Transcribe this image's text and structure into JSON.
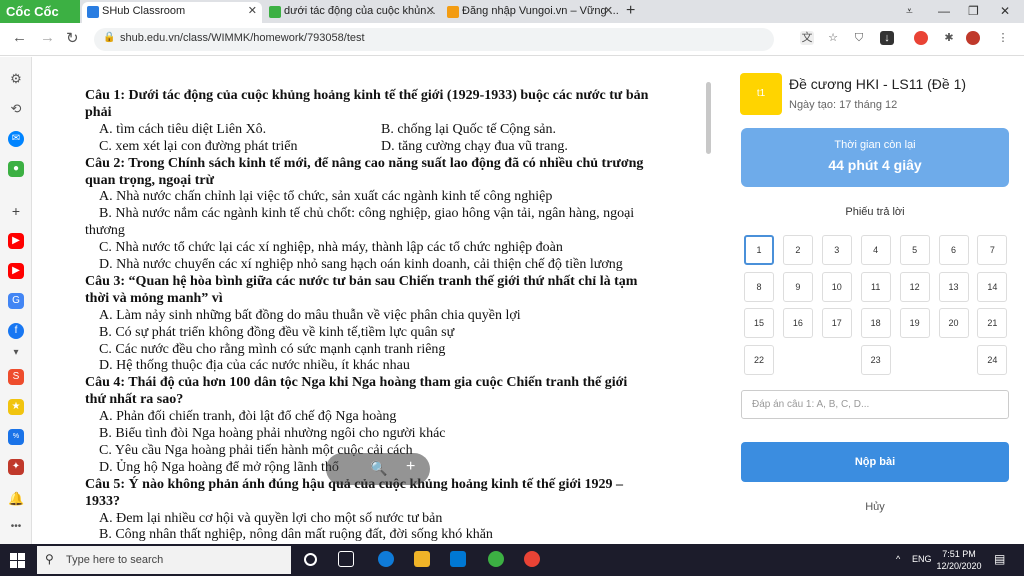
{
  "browser": {
    "brand": "Cốc Cốc",
    "tabs": [
      {
        "title": "SHub Classroom",
        "active": true
      },
      {
        "title": "dưới tác động của cuộc khủn...",
        "active": false
      },
      {
        "title": "Đăng nhập Vungoi.vn – Vững ...",
        "active": false
      }
    ],
    "url": "shub.edu.vn/class/WIMMK/homework/793058/test"
  },
  "document": {
    "lines": [
      {
        "kind": "q",
        "text": "Câu 1: Dưới tác động của cuộc khủng hoảng kinh tế thế giới (1929-1933) buộc các nước tư bản"
      },
      {
        "kind": "q",
        "text": "phải"
      },
      {
        "kind": "pair",
        "left": "A. tìm cách tiêu diệt Liên Xô.",
        "right": "B. chống lại Quốc tế Cộng sản."
      },
      {
        "kind": "pair",
        "left": "C. xem xét lại con đường phát triển",
        "right": "D. tăng cường chạy đua vũ trang."
      },
      {
        "kind": "q",
        "text": "Câu 2: Trong Chính sách kinh tế mới, để nâng cao năng suất lao động đã có nhiều chủ trương"
      },
      {
        "kind": "q",
        "text": "quan trọng, ngoại trừ"
      },
      {
        "kind": "a",
        "text": "A. Nhà nước chấn chỉnh lại việc tổ chức, sản xuất các ngành kinh tế công nghiệp"
      },
      {
        "kind": "a",
        "text": "B. Nhà nước nắm các ngành kinh tế chủ chốt: công nghiệp, giao hông vận tải, ngân hàng, ngoại"
      },
      {
        "kind": "w",
        "text": "thương"
      },
      {
        "kind": "a",
        "text": "C. Nhà nước tổ chức lại các xí nghiệp, nhà máy, thành lập các tổ chức nghiệp đoàn"
      },
      {
        "kind": "a",
        "text": "D. Nhà nước chuyển các xí nghiệp nhỏ sang hạch oán kinh doanh, cải thiện chế độ tiền lương"
      },
      {
        "kind": "q",
        "text": "Câu 3: “Quan hệ hòa bình giữa các nước tư bản sau Chiến tranh thế giới thứ nhất chỉ là tạm"
      },
      {
        "kind": "q",
        "text": "thời và mỏng manh” vì"
      },
      {
        "kind": "a",
        "text": "A. Làm nảy sinh những bất đồng do mâu thuẫn về việc phân chia quyền lợi"
      },
      {
        "kind": "a",
        "text": "B. Có sự phát triển không đồng đều về kinh tế,tiềm lực quân sự"
      },
      {
        "kind": "a",
        "text": "C. Các nước đều cho rằng mình có sức mạnh cạnh tranh riêng"
      },
      {
        "kind": "a",
        "text": "D. Hệ thống thuộc địa của các nước nhiều, ít khác nhau"
      },
      {
        "kind": "q",
        "text": "Câu 4: Thái độ của hơn 100 dân tộc Nga khi Nga hoàng tham gia cuộc Chiến tranh thế giới"
      },
      {
        "kind": "q",
        "text": "thứ nhất ra sao?"
      },
      {
        "kind": "a",
        "text": "A. Phản đối chiến tranh, đòi lật đổ chế độ Nga hoàng"
      },
      {
        "kind": "a",
        "text": "B. Biểu tình đòi Nga hoàng phải nhường ngôi cho người khác"
      },
      {
        "kind": "a",
        "text": "C. Yêu cầu Nga hoàng phải tiến hành một cuộc cải cách"
      },
      {
        "kind": "a",
        "text": "D. Ủng hộ Nga hoàng để mở rộng lãnh thổ"
      },
      {
        "kind": "q",
        "text": "Câu 5: Ý nào không phản ánh đúng hậu quả của cuộc khủng hoảng kinh tế thế giới 1929 –"
      },
      {
        "kind": "q",
        "text": "1933?"
      },
      {
        "kind": "a",
        "text": "A. Đem lại nhiều cơ hội và quyền lợi cho một số nước tư bản"
      },
      {
        "kind": "a",
        "text": "B. Công nhân thất nghiệp, nông dân mất ruộng đất, đời sống khó khăn"
      }
    ]
  },
  "panel": {
    "icon_label": "t1",
    "title": "Đề cương HKI - LS11 (Đề 1)",
    "date": "Ngày tạo: 17 tháng 12",
    "timer_label": "Thời gian còn lại",
    "timer_value": "44 phút 4 giây",
    "sheet_title": "Phiếu trả lời",
    "cells": [
      "1",
      "2",
      "3",
      "4",
      "5",
      "6",
      "7",
      "8",
      "9",
      "10",
      "11",
      "12",
      "13",
      "14",
      "15",
      "16",
      "17",
      "18",
      "19",
      "20",
      "21",
      "22",
      "23",
      "24"
    ],
    "answer_placeholder": "Đáp án câu 1: A, B, C, D...",
    "submit_label": "Nộp bài",
    "cancel_label": "Hủy"
  },
  "taskbar": {
    "search_placeholder": "Type here to search",
    "lang": "ENG",
    "time": "7:51 PM",
    "date": "12/20/2020"
  },
  "colors": {
    "accent": "#3b8de0",
    "timer": "#6eabea",
    "brand_green": "#3cb043",
    "icon_yellow": "#ffd400"
  }
}
